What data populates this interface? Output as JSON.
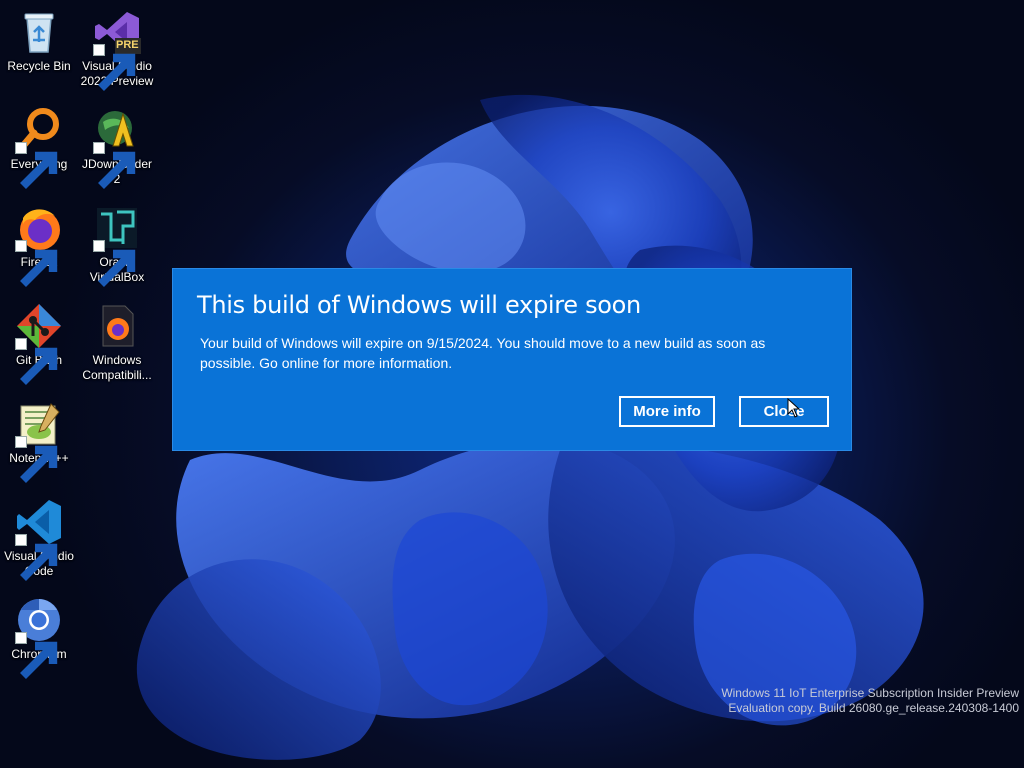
{
  "desktop": {
    "icons": [
      {
        "label": "Recycle Bin",
        "icon": "recycle-bin-icon",
        "shortcut": false
      },
      {
        "label": "Visual Studio 2022 Preview",
        "icon": "visual-studio-preview-icon",
        "shortcut": true,
        "badge": "PRE"
      },
      {
        "label": "Everything",
        "icon": "everything-search-icon",
        "shortcut": true
      },
      {
        "label": "JDownloader 2",
        "icon": "jdownloader-icon",
        "shortcut": true
      },
      {
        "label": "Firefox",
        "icon": "firefox-icon",
        "shortcut": true
      },
      {
        "label": "Oracle VirtualBox",
        "icon": "virtualbox-icon",
        "shortcut": true
      },
      {
        "label": "Git Bash",
        "icon": "git-bash-icon",
        "shortcut": true
      },
      {
        "label": "Windows Compatibili...",
        "icon": "windows-compatibility-icon",
        "shortcut": false
      },
      {
        "label": "Notepad++",
        "icon": "notepad-plus-plus-icon",
        "shortcut": true
      },
      {
        "label": "Visual Studio Code",
        "icon": "vscode-icon",
        "shortcut": true
      },
      {
        "label": "Chromium",
        "icon": "chromium-icon",
        "shortcut": true
      }
    ]
  },
  "dialog": {
    "title": "This build of Windows will expire soon",
    "body": "Your build of Windows will expire on 9/15/2024. You should move to a new build as soon as possible. Go online for more information.",
    "more_info_label": "More info",
    "close_label": "Close",
    "background_color": "#0a73d7"
  },
  "watermark": {
    "line1": "Windows 11 IoT Enterprise Subscription Insider Preview",
    "line2": "Evaluation copy. Build 26080.ge_release.240308-1400"
  }
}
